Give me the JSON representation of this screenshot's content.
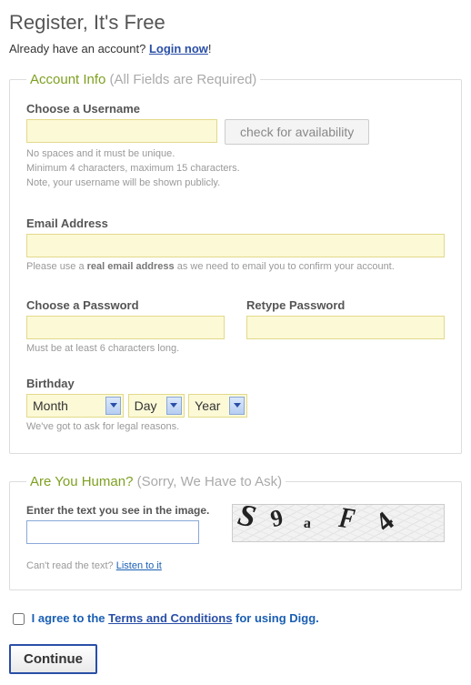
{
  "header": {
    "title": "Register, It's Free",
    "already_text": "Already have an account? ",
    "login_link": "Login now",
    "exclaim": "!"
  },
  "account": {
    "legend_main": "Account Info",
    "legend_sub": " (All Fields are Required)",
    "username_label": "Choose a Username",
    "check_btn": "check for availability",
    "username_hint1": "No spaces and it must be unique.",
    "username_hint2": "Minimum 4 characters, maximum 15 characters.",
    "username_hint3": "Note, your username will be shown publicly.",
    "email_label": "Email Address",
    "email_hint_pre": "Please use a ",
    "email_hint_em": "real email address",
    "email_hint_post": " as we need to email you to confirm your account.",
    "pw_label": "Choose a Password",
    "pw2_label": "Retype Password",
    "pw_hint": "Must be at least 6 characters long.",
    "birthday_label": "Birthday",
    "month": "Month",
    "day": "Day",
    "year": "Year",
    "birthday_hint": "We've got to ask for legal reasons."
  },
  "human": {
    "legend_main": "Are You Human?",
    "legend_sub": " (Sorry, We Have to Ask)",
    "cap_label": "Enter the text you see in the image.",
    "cap_chars": [
      "S",
      "9",
      "a",
      "F",
      "4"
    ],
    "cap_hint_pre": "Can't read the text? ",
    "cap_hint_link": "Listen to it"
  },
  "agree": {
    "pre": "I agree to the ",
    "tcs": "Terms and Conditions",
    "post": " for using Digg."
  },
  "continue": "Continue"
}
